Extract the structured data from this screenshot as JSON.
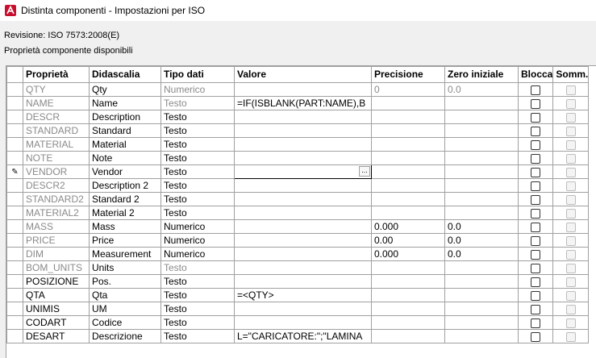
{
  "window": {
    "title": "Distinta componenti - Impostazioni per ISO"
  },
  "revision": "Revisione: ISO 7573:2008(E)",
  "available_label": "Proprietà componente disponibili",
  "columns": [
    "Proprietà",
    "Didascalia",
    "Tipo dati",
    "Valore",
    "Precisione",
    "Zero iniziale",
    "Blocca",
    "Somm."
  ],
  "rows": [
    {
      "prop": "QTY",
      "cap": "Qty",
      "type": "Numerico",
      "value": "",
      "prec": "0",
      "zero": "0.0",
      "custom": false,
      "type_gray": true,
      "num_gray": true
    },
    {
      "prop": "NAME",
      "cap": "Name",
      "type": "Testo",
      "value": "=IF(ISBLANK(PART:NAME),B",
      "prec": "",
      "zero": "",
      "custom": false,
      "type_gray": true,
      "num_gray": false
    },
    {
      "prop": "DESCR",
      "cap": "Description",
      "type": "Testo",
      "value": "",
      "prec": "",
      "zero": "",
      "custom": false,
      "type_gray": false,
      "num_gray": false
    },
    {
      "prop": "STANDARD",
      "cap": "Standard",
      "type": "Testo",
      "value": "",
      "prec": "",
      "zero": "",
      "custom": false,
      "type_gray": false,
      "num_gray": false
    },
    {
      "prop": "MATERIAL",
      "cap": "Material",
      "type": "Testo",
      "value": "",
      "prec": "",
      "zero": "",
      "custom": false,
      "type_gray": false,
      "num_gray": false
    },
    {
      "prop": "NOTE",
      "cap": "Note",
      "type": "Testo",
      "value": "",
      "prec": "",
      "zero": "",
      "custom": false,
      "type_gray": false,
      "num_gray": false
    },
    {
      "prop": "VENDOR",
      "cap": "Vendor",
      "type": "Testo",
      "value": "",
      "prec": "",
      "zero": "",
      "custom": false,
      "type_gray": false,
      "num_gray": false
    },
    {
      "prop": "DESCR2",
      "cap": "Description 2",
      "type": "Testo",
      "value": "",
      "prec": "",
      "zero": "",
      "custom": false,
      "type_gray": false,
      "num_gray": false
    },
    {
      "prop": "STANDARD2",
      "cap": "Standard 2",
      "type": "Testo",
      "value": "",
      "prec": "",
      "zero": "",
      "custom": false,
      "type_gray": false,
      "num_gray": false
    },
    {
      "prop": "MATERIAL2",
      "cap": "Material 2",
      "type": "Testo",
      "value": "",
      "prec": "",
      "zero": "",
      "custom": false,
      "type_gray": false,
      "num_gray": false
    },
    {
      "prop": "MASS",
      "cap": "Mass",
      "type": "Numerico",
      "value": "",
      "prec": "0.000",
      "zero": "0.0",
      "custom": false,
      "type_gray": false,
      "num_gray": false
    },
    {
      "prop": "PRICE",
      "cap": "Price",
      "type": "Numerico",
      "value": "",
      "prec": "0.00",
      "zero": "0.0",
      "custom": false,
      "type_gray": false,
      "num_gray": false
    },
    {
      "prop": "DIM",
      "cap": "Measurement",
      "type": "Numerico",
      "value": "",
      "prec": "0.000",
      "zero": "0.0",
      "custom": false,
      "type_gray": false,
      "num_gray": false
    },
    {
      "prop": "BOM_UNITS",
      "cap": "Units",
      "type": "Testo",
      "value": "",
      "prec": "",
      "zero": "",
      "custom": false,
      "type_gray": true,
      "num_gray": false
    },
    {
      "prop": "POSIZIONE",
      "cap": "Pos.",
      "type": "Testo",
      "value": "",
      "prec": "",
      "zero": "",
      "custom": true,
      "type_gray": false,
      "num_gray": false
    },
    {
      "prop": "QTA",
      "cap": "Qta",
      "type": "Testo",
      "value": "=<QTY>",
      "prec": "",
      "zero": "",
      "custom": true,
      "type_gray": false,
      "num_gray": false
    },
    {
      "prop": "UNIMIS",
      "cap": "UM",
      "type": "Testo",
      "value": "",
      "prec": "",
      "zero": "",
      "custom": true,
      "type_gray": false,
      "num_gray": false
    },
    {
      "prop": "CODART",
      "cap": "Codice",
      "type": "Testo",
      "value": "",
      "prec": "",
      "zero": "",
      "custom": true,
      "type_gray": false,
      "num_gray": false
    },
    {
      "prop": "DESART",
      "cap": "Descrizione",
      "type": "Testo",
      "value": "L=\"CARICATORE:\";\"LAMINA",
      "prec": "",
      "zero": "",
      "custom": true,
      "type_gray": false,
      "num_gray": false
    }
  ],
  "active_row": 6,
  "ellipsis_label": "...",
  "row_pointer": "✎",
  "colors": {
    "gray_text": "#8a8a8a",
    "grid_line": "#a0a0a0",
    "app_icon": "#c8102e"
  }
}
